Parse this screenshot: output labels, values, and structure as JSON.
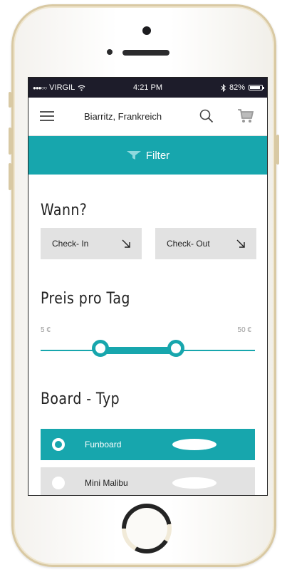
{
  "status": {
    "carrier": "VIRGIL",
    "time": "4:21 PM",
    "battery": "82%"
  },
  "header": {
    "location": "Biarritz, Frankreich"
  },
  "filter": {
    "label": "Filter"
  },
  "when": {
    "title": "Wann?",
    "checkin_label": "Check- In",
    "checkout_label": "Check- Out"
  },
  "price": {
    "title": "Preis pro Tag",
    "min_label": "5 €",
    "max_label": "50 €"
  },
  "board": {
    "title": "Board - Typ",
    "options": [
      {
        "label": "Funboard",
        "selected": true
      },
      {
        "label": "Mini Malibu",
        "selected": false
      }
    ]
  },
  "colors": {
    "accent": "#17a6ad",
    "statusbar": "#1d1c2a",
    "button_bg": "#e2e2e2"
  }
}
